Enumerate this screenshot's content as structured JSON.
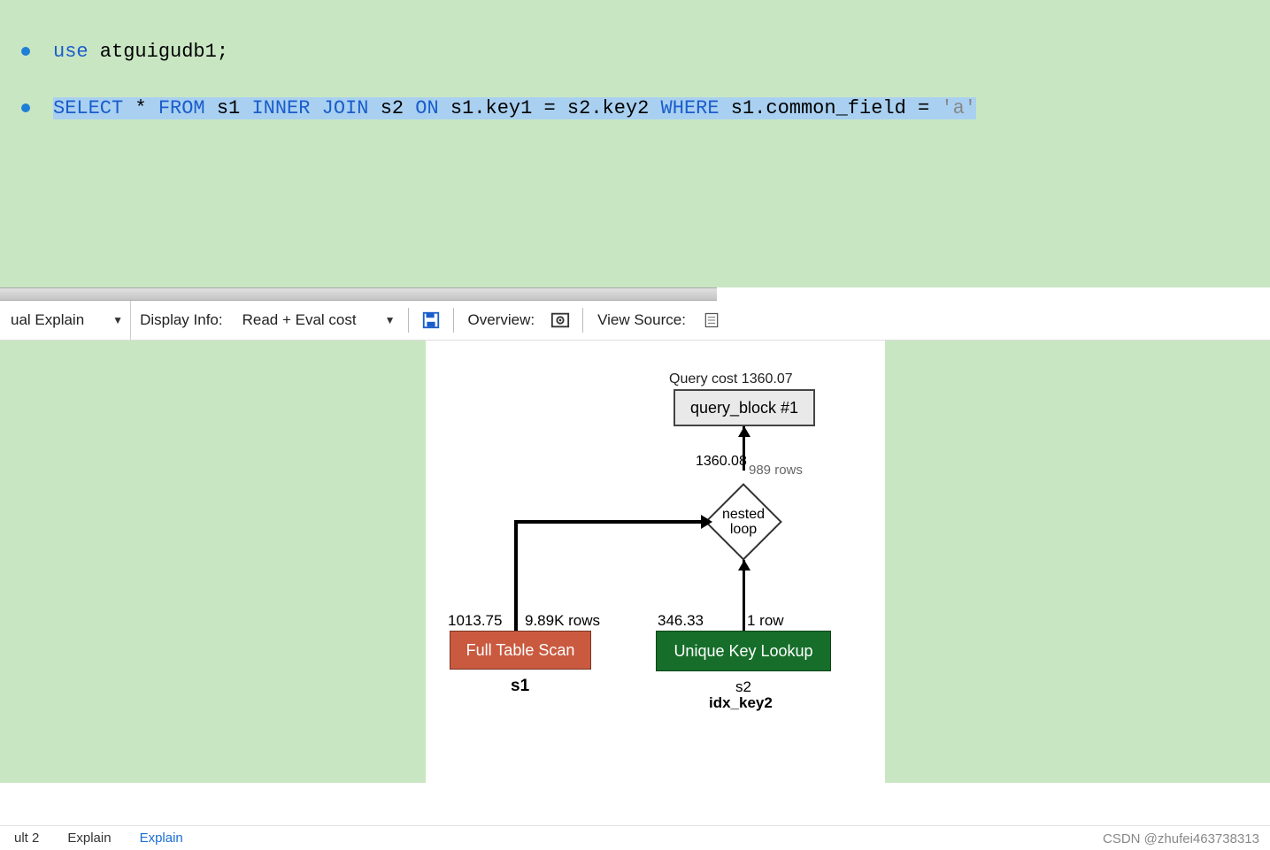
{
  "editor": {
    "line2_bullet": true,
    "line2": "use atguigudb1;",
    "line4_bullet": true,
    "line4_tokens": {
      "t1": "SELECT",
      "star": "*",
      "t2": "FROM",
      "s1": "s1",
      "t3": "INNER",
      "t4": "JOIN",
      "s2": "s2",
      "t5": "ON",
      "e1": "s1.key1 = s2.key2",
      "t6": "WHERE",
      "e2": "s1.common_field = ",
      "str": "'a'"
    }
  },
  "toolbar": {
    "explain_dropdown": "ual Explain",
    "display_info_label": "Display Info:",
    "cost_dropdown": "Read + Eval cost",
    "overview_label": "Overview:",
    "view_source_label": "View Source:"
  },
  "diagram": {
    "query_cost_label": "Query cost 1360.07",
    "query_block": "query_block #1",
    "cost1": "1360.08",
    "rows1": "989 rows",
    "diamond": "nested\nloop",
    "left_cost": "1013.75",
    "left_rows": "9.89K rows",
    "right_cost": "346.33",
    "right_rows": "1 row",
    "red_box": "Full Table Scan",
    "green_box": "Unique Key Lookup",
    "s1": "s1",
    "s2": "s2",
    "idx": "idx_key2"
  },
  "bottom": {
    "tab1": "ult 2",
    "tab2": "Explain",
    "tab3": "Explain"
  },
  "watermark": "CSDN @zhufei463738313"
}
